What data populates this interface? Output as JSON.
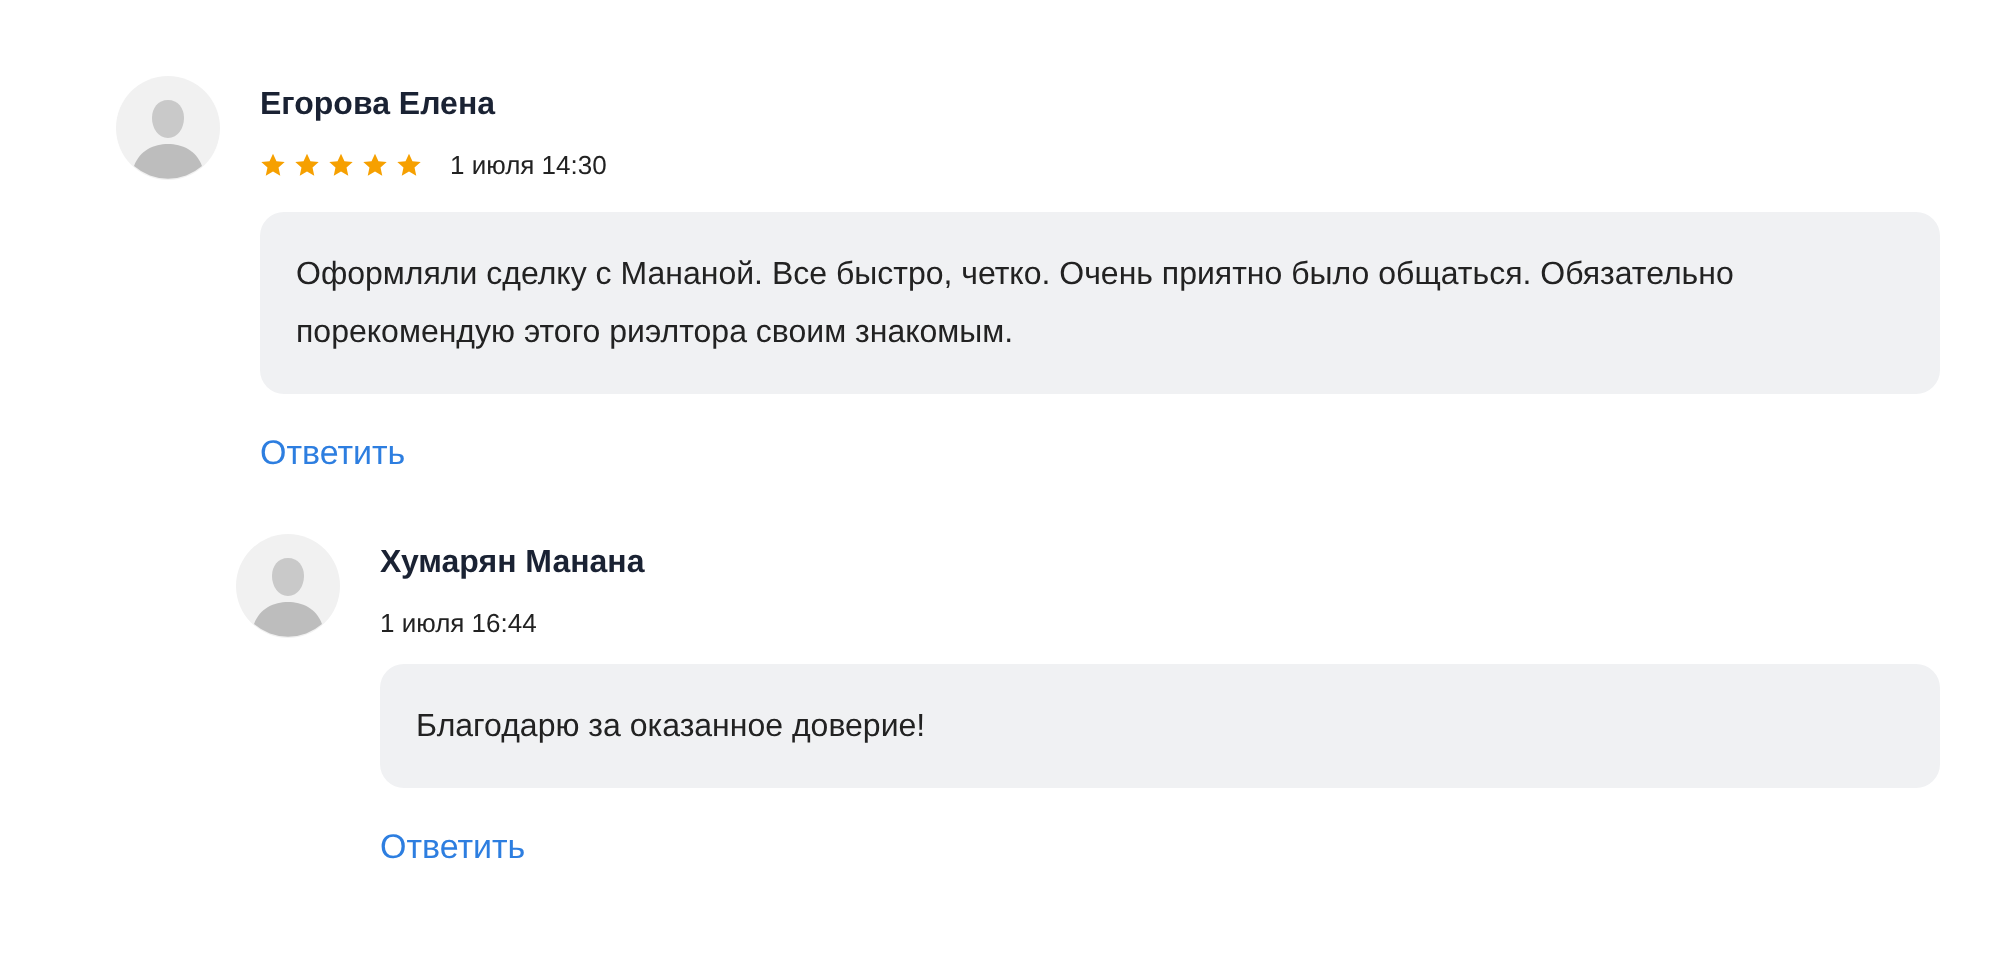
{
  "reviews": [
    {
      "author": "Егорова Елена",
      "stars": 5,
      "date": "1 июля 14:30",
      "text": "Оформляли сделку с Мананой. Все быстро, четко. Очень приятно было общаться. Обязательно порекомендую этого риэлтора своим знакомым.",
      "reply_label": "Ответить",
      "replies": [
        {
          "author": "Хумарян Манана",
          "date": "1 июля 16:44",
          "text": "Благодарю за оказанное доверие!",
          "reply_label": "Ответить"
        }
      ]
    }
  ]
}
